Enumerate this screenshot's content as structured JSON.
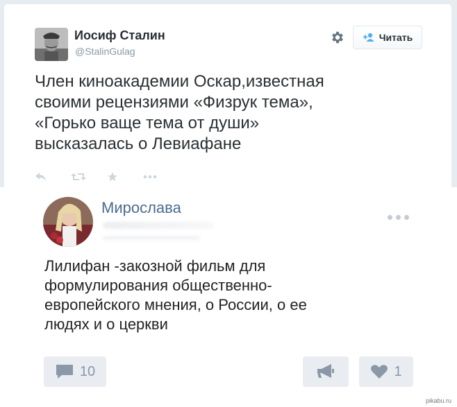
{
  "tweet": {
    "user_name": "Иосиф Сталин",
    "user_handle": "@StalinGulag",
    "follow_label": "Читать",
    "text": "Член киноакадемии Оскар,известная\nсвоими рецензиями «Физрук тема»,\n«Горько ваще тема от души»\nвысказалась о Левиафане",
    "actions": [
      "reply-icon",
      "retweet-icon",
      "favorite-icon",
      "more-icon"
    ]
  },
  "embed": {
    "author": "Мирослава",
    "text": "Лилифан -закозной фильм для\nформулирования общественно-\nевропейского мнения, о России, о ее\nлюдях и о церкви",
    "comments_count": "10",
    "likes_count": "1"
  },
  "watermark": "pikabu.ru",
  "colors": {
    "background": "#e6ecf0",
    "text": "#292f33",
    "muted": "#8899a6",
    "vk_name": "#4a6b8f",
    "vk_button_bg": "#e9edf1",
    "vk_icon": "#8a98a8"
  }
}
